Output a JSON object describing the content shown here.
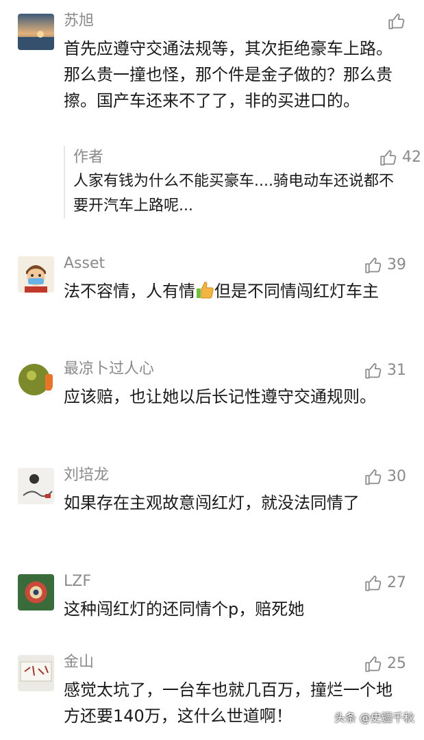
{
  "comments": [
    {
      "name": "苏旭",
      "text": "首先应遵守交通法规等，其次拒绝豪车上路。那么贵一撞也怪，那个件是金子做的？那么贵擦。国产车还来不了了，非的买进口的。",
      "likes": null,
      "reply": {
        "name": "作者",
        "text": "人家有钱为什么不能买豪车....骑电动车还说都不要开汽车上路呢...",
        "likes": "42"
      }
    },
    {
      "name": "Asset",
      "text_before": "法不容情，人有情",
      "emoji": "thumbs-up-emoji",
      "text_after": "但是不同情闯红灯车主",
      "likes": "39"
    },
    {
      "name": "最凉卜过人心",
      "text": "应该赔，也让她以后长记性遵守交通规则。",
      "likes": "31"
    },
    {
      "name": "刘培龙",
      "text": "如果存在主观故意闯红灯，就没法同情了",
      "likes": "30"
    },
    {
      "name": "LZF",
      "text": "这种闯红灯的还同情个p，赔死她",
      "likes": "27"
    },
    {
      "name": "金山",
      "text": "感觉太坑了，一台车也就几百万，撞烂一个地方还要140万，这什么世道啊！",
      "likes": "25"
    }
  ],
  "watermark": {
    "text": "头条 @史疆千秋"
  },
  "icons": {
    "like": "thumbs-up-outline-icon"
  },
  "colors": {
    "text": "#1a1a1a",
    "meta": "#8a8a8a",
    "background": "#ffffff"
  }
}
